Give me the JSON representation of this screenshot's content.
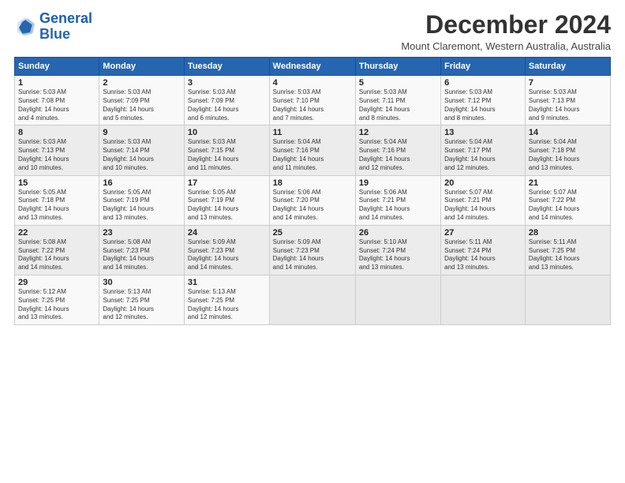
{
  "logo": {
    "line1": "General",
    "line2": "Blue"
  },
  "title": "December 2024",
  "subtitle": "Mount Claremont, Western Australia, Australia",
  "weekdays": [
    "Sunday",
    "Monday",
    "Tuesday",
    "Wednesday",
    "Thursday",
    "Friday",
    "Saturday"
  ],
  "weeks": [
    [
      {
        "day": "1",
        "lines": [
          "Sunrise: 5:03 AM",
          "Sunset: 7:08 PM",
          "Daylight: 14 hours",
          "and 4 minutes."
        ]
      },
      {
        "day": "2",
        "lines": [
          "Sunrise: 5:03 AM",
          "Sunset: 7:09 PM",
          "Daylight: 14 hours",
          "and 5 minutes."
        ]
      },
      {
        "day": "3",
        "lines": [
          "Sunrise: 5:03 AM",
          "Sunset: 7:09 PM",
          "Daylight: 14 hours",
          "and 6 minutes."
        ]
      },
      {
        "day": "4",
        "lines": [
          "Sunrise: 5:03 AM",
          "Sunset: 7:10 PM",
          "Daylight: 14 hours",
          "and 7 minutes."
        ]
      },
      {
        "day": "5",
        "lines": [
          "Sunrise: 5:03 AM",
          "Sunset: 7:11 PM",
          "Daylight: 14 hours",
          "and 8 minutes."
        ]
      },
      {
        "day": "6",
        "lines": [
          "Sunrise: 5:03 AM",
          "Sunset: 7:12 PM",
          "Daylight: 14 hours",
          "and 8 minutes."
        ]
      },
      {
        "day": "7",
        "lines": [
          "Sunrise: 5:03 AM",
          "Sunset: 7:13 PM",
          "Daylight: 14 hours",
          "and 9 minutes."
        ]
      }
    ],
    [
      {
        "day": "8",
        "lines": [
          "Sunrise: 5:03 AM",
          "Sunset: 7:13 PM",
          "Daylight: 14 hours",
          "and 10 minutes."
        ]
      },
      {
        "day": "9",
        "lines": [
          "Sunrise: 5:03 AM",
          "Sunset: 7:14 PM",
          "Daylight: 14 hours",
          "and 10 minutes."
        ]
      },
      {
        "day": "10",
        "lines": [
          "Sunrise: 5:03 AM",
          "Sunset: 7:15 PM",
          "Daylight: 14 hours",
          "and 11 minutes."
        ]
      },
      {
        "day": "11",
        "lines": [
          "Sunrise: 5:04 AM",
          "Sunset: 7:16 PM",
          "Daylight: 14 hours",
          "and 11 minutes."
        ]
      },
      {
        "day": "12",
        "lines": [
          "Sunrise: 5:04 AM",
          "Sunset: 7:16 PM",
          "Daylight: 14 hours",
          "and 12 minutes."
        ]
      },
      {
        "day": "13",
        "lines": [
          "Sunrise: 5:04 AM",
          "Sunset: 7:17 PM",
          "Daylight: 14 hours",
          "and 12 minutes."
        ]
      },
      {
        "day": "14",
        "lines": [
          "Sunrise: 5:04 AM",
          "Sunset: 7:18 PM",
          "Daylight: 14 hours",
          "and 13 minutes."
        ]
      }
    ],
    [
      {
        "day": "15",
        "lines": [
          "Sunrise: 5:05 AM",
          "Sunset: 7:18 PM",
          "Daylight: 14 hours",
          "and 13 minutes."
        ]
      },
      {
        "day": "16",
        "lines": [
          "Sunrise: 5:05 AM",
          "Sunset: 7:19 PM",
          "Daylight: 14 hours",
          "and 13 minutes."
        ]
      },
      {
        "day": "17",
        "lines": [
          "Sunrise: 5:05 AM",
          "Sunset: 7:19 PM",
          "Daylight: 14 hours",
          "and 13 minutes."
        ]
      },
      {
        "day": "18",
        "lines": [
          "Sunrise: 5:06 AM",
          "Sunset: 7:20 PM",
          "Daylight: 14 hours",
          "and 14 minutes."
        ]
      },
      {
        "day": "19",
        "lines": [
          "Sunrise: 5:06 AM",
          "Sunset: 7:21 PM",
          "Daylight: 14 hours",
          "and 14 minutes."
        ]
      },
      {
        "day": "20",
        "lines": [
          "Sunrise: 5:07 AM",
          "Sunset: 7:21 PM",
          "Daylight: 14 hours",
          "and 14 minutes."
        ]
      },
      {
        "day": "21",
        "lines": [
          "Sunrise: 5:07 AM",
          "Sunset: 7:22 PM",
          "Daylight: 14 hours",
          "and 14 minutes."
        ]
      }
    ],
    [
      {
        "day": "22",
        "lines": [
          "Sunrise: 5:08 AM",
          "Sunset: 7:22 PM",
          "Daylight: 14 hours",
          "and 14 minutes."
        ]
      },
      {
        "day": "23",
        "lines": [
          "Sunrise: 5:08 AM",
          "Sunset: 7:23 PM",
          "Daylight: 14 hours",
          "and 14 minutes."
        ]
      },
      {
        "day": "24",
        "lines": [
          "Sunrise: 5:09 AM",
          "Sunset: 7:23 PM",
          "Daylight: 14 hours",
          "and 14 minutes."
        ]
      },
      {
        "day": "25",
        "lines": [
          "Sunrise: 5:09 AM",
          "Sunset: 7:23 PM",
          "Daylight: 14 hours",
          "and 14 minutes."
        ]
      },
      {
        "day": "26",
        "lines": [
          "Sunrise: 5:10 AM",
          "Sunset: 7:24 PM",
          "Daylight: 14 hours",
          "and 13 minutes."
        ]
      },
      {
        "day": "27",
        "lines": [
          "Sunrise: 5:11 AM",
          "Sunset: 7:24 PM",
          "Daylight: 14 hours",
          "and 13 minutes."
        ]
      },
      {
        "day": "28",
        "lines": [
          "Sunrise: 5:11 AM",
          "Sunset: 7:25 PM",
          "Daylight: 14 hours",
          "and 13 minutes."
        ]
      }
    ],
    [
      {
        "day": "29",
        "lines": [
          "Sunrise: 5:12 AM",
          "Sunset: 7:25 PM",
          "Daylight: 14 hours",
          "and 13 minutes."
        ]
      },
      {
        "day": "30",
        "lines": [
          "Sunrise: 5:13 AM",
          "Sunset: 7:25 PM",
          "Daylight: 14 hours",
          "and 12 minutes."
        ]
      },
      {
        "day": "31",
        "lines": [
          "Sunrise: 5:13 AM",
          "Sunset: 7:25 PM",
          "Daylight: 14 hours",
          "and 12 minutes."
        ]
      },
      null,
      null,
      null,
      null
    ]
  ]
}
